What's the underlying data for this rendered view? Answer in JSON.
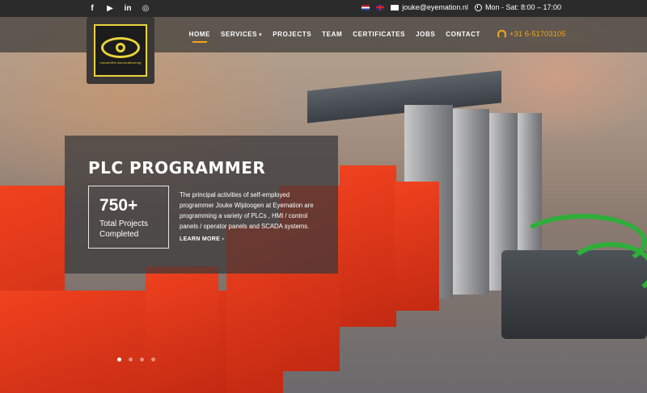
{
  "topbar": {
    "socials": [
      {
        "icon": "facebook-icon",
        "glyph": "f"
      },
      {
        "icon": "youtube-icon",
        "glyph": "▶"
      },
      {
        "icon": "linkedin-icon",
        "glyph": "in"
      },
      {
        "icon": "instagram-icon",
        "glyph": "◎"
      }
    ],
    "email": "jouke@eyemation.nl",
    "hours": "Mon - Sat: 8:00 – 17:00"
  },
  "logo": {
    "tagline": "Industriële Automatisering"
  },
  "menu": {
    "items": [
      "HOME",
      "SERVICES",
      "PROJECTS",
      "TEAM",
      "CERTIFICATES",
      "JOBS",
      "CONTACT"
    ],
    "active": "HOME",
    "services_has_dropdown": true
  },
  "phone": "+31 6-51703105",
  "hero": {
    "title": "PLC PROGRAMMER",
    "stat_value": "750+",
    "stat_label": "Total Projects Completed",
    "description": "The principal activities of self-employed programmer Jouke Wijdoogen at Eyemation are programming a variety of PLCs , HMI / control panels / operator panels and SCADA systems.",
    "learn_more": "LEARN MORE"
  },
  "slider": {
    "count": 4,
    "active_index": 0
  },
  "colors": {
    "accent": "#f2a51a",
    "logo_yellow": "#e8d43a",
    "topbar": "#2b2b2b"
  }
}
